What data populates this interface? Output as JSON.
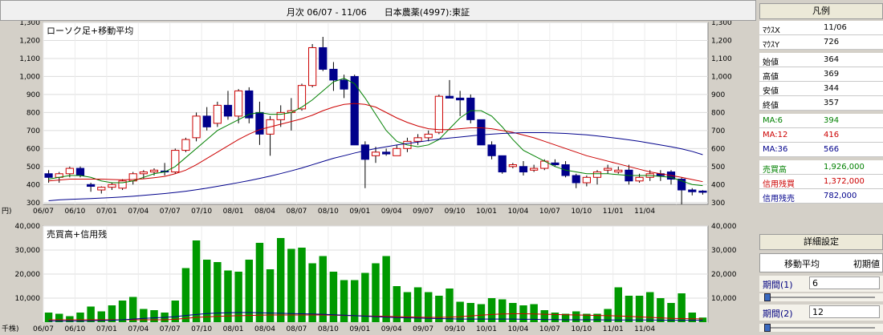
{
  "header": {
    "title": "月次 06/07 - 11/06　　日本農薬(4997):東証"
  },
  "chart_data": [
    {
      "type": "candlestick",
      "title": "ローソク足+移動平均",
      "unit_label": "円)",
      "ylim": [
        290,
        1300
      ],
      "yticks": [
        300,
        400,
        500,
        600,
        700,
        800,
        900,
        1000,
        1100,
        1200,
        1300
      ],
      "ytick_labels": [
        "300",
        "400",
        "500",
        "600",
        "700",
        "800",
        "900",
        "1,000",
        "1,100",
        "1,200",
        "1,300"
      ],
      "x_labels": [
        "06/07",
        "06/10",
        "07/01",
        "07/04",
        "07/07",
        "07/10",
        "08/01",
        "08/04",
        "08/07",
        "08/10",
        "09/01",
        "09/04",
        "09/07",
        "09/10",
        "10/01",
        "10/04",
        "10/07",
        "10/10",
        "11/01",
        "11/04"
      ],
      "candles": [
        [
          460,
          480,
          410,
          440
        ],
        [
          440,
          470,
          410,
          460
        ],
        [
          460,
          500,
          440,
          490
        ],
        [
          490,
          500,
          440,
          450
        ],
        [
          400,
          410,
          360,
          390
        ],
        [
          370,
          390,
          350,
          385
        ],
        [
          385,
          410,
          370,
          400
        ],
        [
          380,
          430,
          370,
          420
        ],
        [
          420,
          470,
          400,
          460
        ],
        [
          460,
          480,
          430,
          470
        ],
        [
          470,
          490,
          450,
          480
        ],
        [
          475,
          520,
          450,
          470
        ],
        [
          470,
          600,
          460,
          590
        ],
        [
          590,
          660,
          580,
          650
        ],
        [
          660,
          800,
          640,
          780
        ],
        [
          780,
          830,
          700,
          720
        ],
        [
          740,
          860,
          720,
          840
        ],
        [
          840,
          920,
          760,
          780
        ],
        [
          780,
          930,
          740,
          920
        ],
        [
          920,
          940,
          740,
          770
        ],
        [
          800,
          860,
          620,
          680
        ],
        [
          680,
          780,
          560,
          760
        ],
        [
          760,
          840,
          720,
          800
        ],
        [
          800,
          880,
          700,
          810
        ],
        [
          820,
          960,
          810,
          950
        ],
        [
          950,
          1180,
          940,
          1160
        ],
        [
          1160,
          1220,
          1030,
          1040
        ],
        [
          1040,
          1080,
          920,
          980
        ],
        [
          980,
          1010,
          880,
          930
        ],
        [
          1000,
          1010,
          650,
          620
        ],
        [
          620,
          640,
          380,
          540
        ],
        [
          560,
          610,
          520,
          580
        ],
        [
          580,
          600,
          560,
          570
        ],
        [
          560,
          620,
          560,
          600
        ],
        [
          600,
          660,
          580,
          640
        ],
        [
          640,
          680,
          620,
          660
        ],
        [
          660,
          700,
          640,
          680
        ],
        [
          690,
          900,
          680,
          890
        ],
        [
          890,
          980,
          880,
          880
        ],
        [
          880,
          920,
          780,
          870
        ],
        [
          880,
          900,
          740,
          760
        ],
        [
          760,
          760,
          620,
          620
        ],
        [
          620,
          640,
          540,
          560
        ],
        [
          560,
          560,
          460,
          470
        ],
        [
          500,
          520,
          490,
          510
        ],
        [
          500,
          530,
          450,
          470
        ],
        [
          480,
          510,
          470,
          490
        ],
        [
          490,
          540,
          480,
          530
        ],
        [
          520,
          540,
          500,
          510
        ],
        [
          510,
          530,
          440,
          450
        ],
        [
          450,
          460,
          380,
          410
        ],
        [
          410,
          450,
          390,
          440
        ],
        [
          440,
          480,
          400,
          470
        ],
        [
          480,
          510,
          460,
          490
        ],
        [
          470,
          500,
          460,
          480
        ],
        [
          480,
          510,
          400,
          420
        ],
        [
          420,
          460,
          410,
          440
        ],
        [
          440,
          480,
          420,
          460
        ],
        [
          460,
          480,
          420,
          450
        ],
        [
          470,
          480,
          400,
          430
        ],
        [
          430,
          440,
          290,
          370
        ],
        [
          370,
          380,
          340,
          360
        ],
        [
          364,
          369,
          344,
          357
        ]
      ],
      "series": [
        {
          "name": "MA:6",
          "color": "#008000",
          "values": [
            430,
            440,
            450,
            450,
            440,
            420,
            410,
            410,
            420,
            440,
            460,
            470,
            500,
            550,
            600,
            650,
            700,
            730,
            760,
            790,
            800,
            790,
            790,
            800,
            830,
            870,
            920,
            970,
            990,
            960,
            880,
            790,
            700,
            640,
            620,
            610,
            620,
            650,
            710,
            770,
            810,
            810,
            780,
            720,
            650,
            590,
            560,
            530,
            500,
            480,
            470,
            460,
            460,
            460,
            455,
            450,
            450,
            450,
            445,
            440,
            420,
            400,
            394
          ]
        },
        {
          "name": "MA:12",
          "color": "#cc0000",
          "values": [
            420,
            425,
            430,
            430,
            430,
            430,
            428,
            426,
            428,
            432,
            438,
            445,
            460,
            480,
            510,
            545,
            580,
            615,
            650,
            680,
            705,
            720,
            735,
            750,
            765,
            785,
            810,
            830,
            845,
            850,
            845,
            830,
            800,
            770,
            745,
            725,
            710,
            705,
            705,
            710,
            715,
            715,
            710,
            700,
            690,
            675,
            660,
            640,
            620,
            600,
            580,
            560,
            545,
            530,
            515,
            500,
            485,
            470,
            460,
            450,
            440,
            428,
            416
          ]
        },
        {
          "name": "MA:36",
          "color": "#00008b",
          "values": [
            310,
            315,
            318,
            320,
            322,
            325,
            328,
            331,
            335,
            340,
            345,
            350,
            356,
            363,
            371,
            380,
            390,
            400,
            411,
            422,
            434,
            447,
            461,
            476,
            492,
            510,
            528,
            546,
            560,
            575,
            588,
            600,
            610,
            620,
            628,
            636,
            644,
            652,
            658,
            664,
            670,
            676,
            680,
            684,
            686,
            688,
            688,
            688,
            686,
            684,
            680,
            676,
            670,
            663,
            656,
            648,
            640,
            630,
            620,
            610,
            598,
            584,
            566
          ]
        }
      ]
    },
    {
      "type": "bar",
      "title": "売買高+信用残",
      "unit_label": "千株)",
      "ylim": [
        0,
        40000
      ],
      "yticks": [
        0,
        10000,
        20000,
        30000,
        40000
      ],
      "ytick_labels": [
        "",
        "10,000",
        "20,000",
        "30,000",
        "40,000"
      ],
      "x_labels": [
        "06/07",
        "06/10",
        "07/01",
        "07/04",
        "07/07",
        "07/10",
        "08/01",
        "08/04",
        "08/07",
        "08/10",
        "09/01",
        "09/04",
        "09/07",
        "09/10",
        "10/01",
        "10/04",
        "10/07",
        "10/10",
        "11/01",
        "11/04"
      ],
      "series": [
        {
          "name": "売買高",
          "color": "#009900",
          "values": [
            4000,
            3500,
            2500,
            4000,
            6500,
            4500,
            7000,
            9000,
            10500,
            5500,
            5000,
            4000,
            9000,
            22500,
            34000,
            26000,
            25000,
            21500,
            21000,
            26000,
            33000,
            22000,
            35000,
            30500,
            31000,
            24500,
            27500,
            21000,
            17500,
            17500,
            20500,
            24500,
            27500,
            15000,
            12500,
            14500,
            12500,
            11000,
            14000,
            8500,
            8000,
            7500,
            10000,
            9500,
            8000,
            7000,
            7500,
            5000,
            4000,
            3500,
            4500,
            3500,
            3500,
            5500,
            14500,
            11000,
            11000,
            12500,
            10000,
            8000,
            12000,
            4000,
            1926
          ]
        },
        {
          "name": "信用残買",
          "color": "#cc0000",
          "values": [
            1000,
            1000,
            1000,
            1000,
            1000,
            1000,
            1000,
            1000,
            1000,
            1000,
            1000,
            1000,
            1200,
            1600,
            2000,
            2200,
            2400,
            2600,
            2700,
            2800,
            2900,
            3000,
            3000,
            3000,
            3000,
            3000,
            3000,
            2900,
            2800,
            2700,
            2600,
            2500,
            2400,
            2300,
            2200,
            2100,
            2000,
            2000,
            2100,
            2300,
            2600,
            2900,
            3200,
            3400,
            3500,
            3500,
            3400,
            3300,
            3200,
            3100,
            3000,
            2900,
            2800,
            2700,
            2600,
            2400,
            2200,
            2000,
            1800,
            1600,
            1500,
            1400,
            1372
          ]
        },
        {
          "name": "信用残売",
          "color": "#00008b",
          "values": [
            500,
            500,
            500,
            500,
            600,
            700,
            800,
            1000,
            1300,
            1600,
            1800,
            2000,
            2300,
            2800,
            3200,
            3600,
            3800,
            3900,
            4000,
            4000,
            3900,
            3800,
            3700,
            3600,
            3500,
            3400,
            3300,
            3100,
            2900,
            2700,
            2500,
            2300,
            2100,
            1900,
            1800,
            1700,
            1600,
            1500,
            1400,
            1300,
            1300,
            1300,
            1300,
            1300,
            1300,
            1200,
            1200,
            1100,
            1100,
            1000,
            1000,
            1000,
            1000,
            900,
            900,
            900,
            900,
            900,
            850,
            800,
            800,
            790,
            782
          ]
        }
      ]
    }
  ],
  "legend": {
    "title": "凡例",
    "mouse": [
      {
        "k": "ﾏｳｽX",
        "v": "11/06"
      },
      {
        "k": "ﾏｳｽY",
        "v": "726"
      }
    ],
    "ohlc": [
      {
        "k": "始値",
        "v": "364"
      },
      {
        "k": "高値",
        "v": "369"
      },
      {
        "k": "安値",
        "v": "344"
      },
      {
        "k": "終値",
        "v": "357"
      }
    ],
    "ma": [
      {
        "k": "MA:6",
        "v": "394",
        "color": "#008000"
      },
      {
        "k": "MA:12",
        "v": "416",
        "color": "#cc0000"
      },
      {
        "k": "MA:36",
        "v": "566",
        "color": "#00008b"
      }
    ],
    "volume": [
      {
        "k": "売買高",
        "v": "1,926,000",
        "color": "#008000"
      },
      {
        "k": "信用残買",
        "v": "1,372,000",
        "color": "#cc0000"
      },
      {
        "k": "信用残売",
        "v": "782,000",
        "color": "#00008b"
      }
    ]
  },
  "settings": {
    "title": "詳細設定",
    "tab_ma": "移動平均",
    "tab_init": "初期値",
    "period1_label": "期間(1)",
    "period1_value": "6",
    "period2_label": "期間(2)",
    "period2_value": "12"
  },
  "colors": {
    "up_candle": "#cc0000",
    "down_candle": "#00008b",
    "plot_bg": "#ffffff",
    "volume": "#009900"
  }
}
